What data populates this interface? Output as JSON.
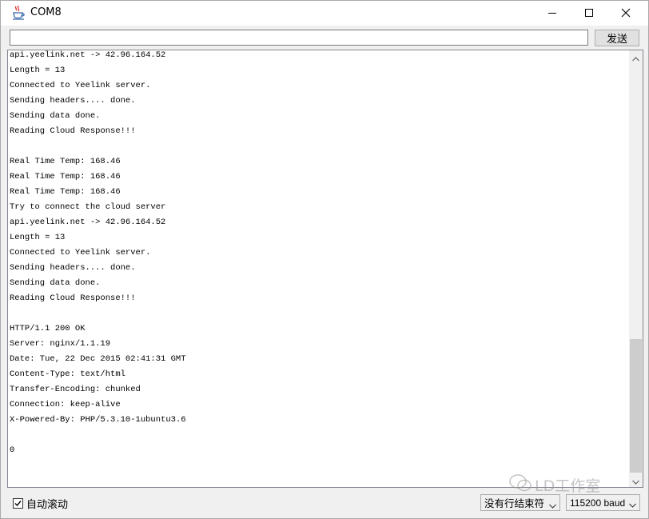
{
  "window": {
    "title": "COM8"
  },
  "send": {
    "input_value": "",
    "button_label": "发送"
  },
  "output": {
    "lines": [
      "api.yeelink.net -> 42.96.164.52",
      "Length = 13",
      "Connected to Yeelink server.",
      "Sending headers.... done.",
      "Sending data done.",
      "Reading Cloud Response!!!",
      "",
      "Real Time Temp: 168.46",
      "Real Time Temp: 168.46",
      "Real Time Temp: 168.46",
      "Try to connect the cloud server",
      "api.yeelink.net -> 42.96.164.52",
      "Length = 13",
      "Connected to Yeelink server.",
      "Sending headers.... done.",
      "Sending data done.",
      "Reading Cloud Response!!!",
      "",
      "HTTP/1.1 200 OK",
      "Server: nginx/1.1.19",
      "Date: Tue, 22 Dec 2015 02:41:31 GMT",
      "Content-Type: text/html",
      "Transfer-Encoding: chunked",
      "Connection: keep-alive",
      "X-Powered-By: PHP/5.3.10-1ubuntu3.6",
      "",
      "0"
    ]
  },
  "status": {
    "autoscroll_label": "自动滚动",
    "autoscroll_checked": true,
    "line_ending": "没有行结束符",
    "baud_rate": "115200 baud"
  },
  "watermark": {
    "text": "LD工作室"
  },
  "icons": {
    "app": "java-cup-icon",
    "minimize": "minimize-icon",
    "maximize": "maximize-icon",
    "close": "close-icon",
    "scroll_up": "chevron-up-icon",
    "scroll_down": "chevron-down-icon",
    "wechat": "wechat-icon"
  }
}
